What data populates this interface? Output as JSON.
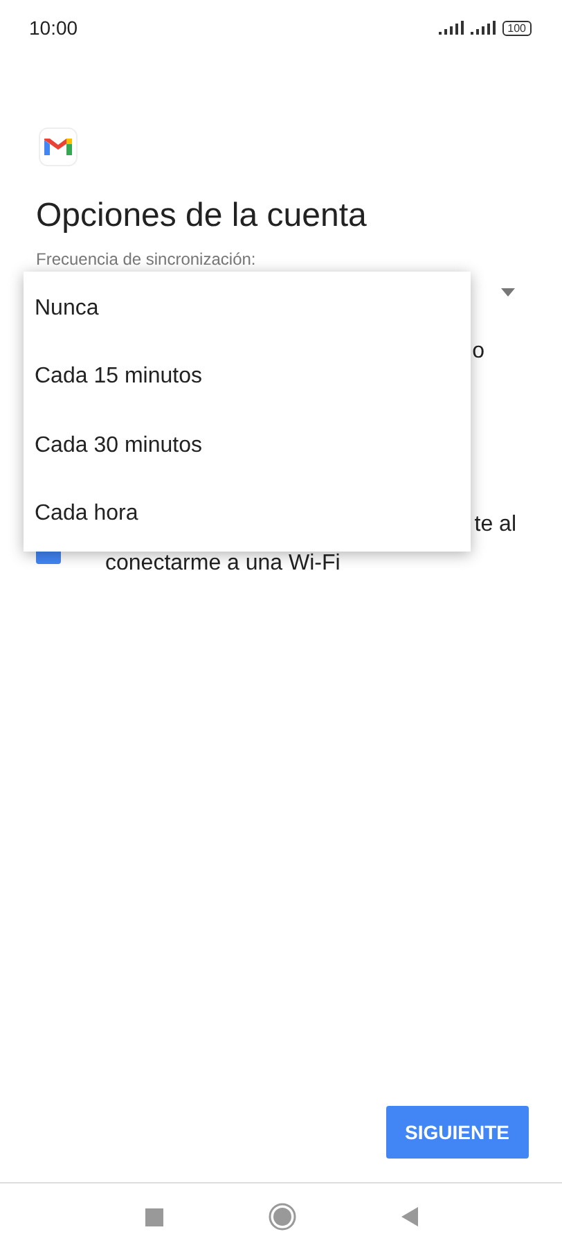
{
  "status_bar": {
    "time": "10:00",
    "battery": "100"
  },
  "title": "Opciones de la cuenta",
  "sync_label": "Frecuencia de sincronización:",
  "background_fragments": {
    "line_1": "o",
    "line_2": "te al",
    "line_3": "conectarme a una Wi-Fi",
    "checkbox": {
      "checked": true
    }
  },
  "dropdown_menu": {
    "options": [
      {
        "label": "Nunca"
      },
      {
        "label": "Cada 15 minutos"
      },
      {
        "label": "Cada 30 minutos"
      },
      {
        "label": "Cada hora"
      }
    ]
  },
  "next_button": "SIGUIENTE"
}
